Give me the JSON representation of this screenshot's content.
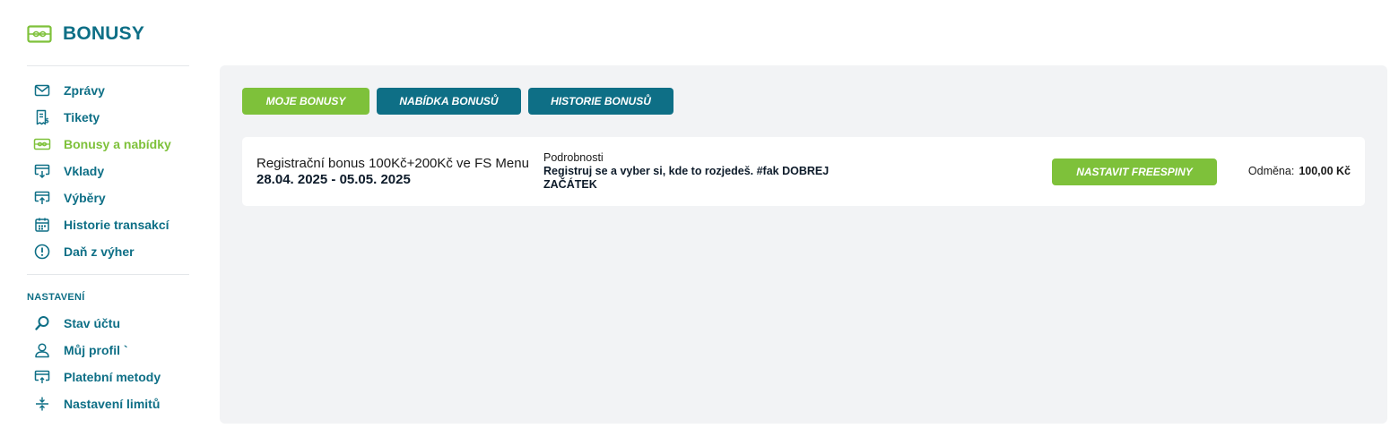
{
  "header": {
    "title": "BONUSY",
    "icon": "ticket-bow-icon"
  },
  "sidebar": {
    "items": [
      {
        "label": "Zprávy",
        "icon": "envelope-icon"
      },
      {
        "label": "Tikety",
        "icon": "receipt-icon"
      },
      {
        "label": "Bonusy a nabídky",
        "icon": "ticket-bow-icon",
        "active": true
      },
      {
        "label": "Vklady",
        "icon": "deposit-icon"
      },
      {
        "label": "Výběry",
        "icon": "withdraw-icon"
      },
      {
        "label": "Historie transakcí",
        "icon": "calendar-icon"
      },
      {
        "label": "Daň z výher",
        "icon": "exclamation-circle-icon"
      }
    ],
    "settings_title": "NASTAVENÍ",
    "settings_items": [
      {
        "label": "Stav účtu",
        "icon": "magnifier-icon"
      },
      {
        "label": "Můj profil `",
        "icon": "user-icon"
      },
      {
        "label": "Platební metody",
        "icon": "card-icon"
      },
      {
        "label": "Nastavení limitů",
        "icon": "limits-icon"
      }
    ]
  },
  "tabs": {
    "my_bonuses": "MOJE BONUSY",
    "offer": "NABÍDKA BONUSŮ",
    "history": "HISTORIE BONUSŮ"
  },
  "bonus": {
    "name": "Registrační bonus 100Kč+200Kč ve FS Menu",
    "dates": "28.04. 2025 - 05.05. 2025",
    "details_label": "Podrobnosti",
    "details_text": "Registruj se a vyber si, kde to rozjedeš. #fak DOBREJ ZAČÁTEK",
    "button_label": "NASTAVIT FREESPINY",
    "reward_label": "Odměna:",
    "reward_value": "100,00 Kč"
  },
  "colors": {
    "teal": "#0e6f86",
    "green": "#7ec13a",
    "panel": "#f2f3f5"
  }
}
